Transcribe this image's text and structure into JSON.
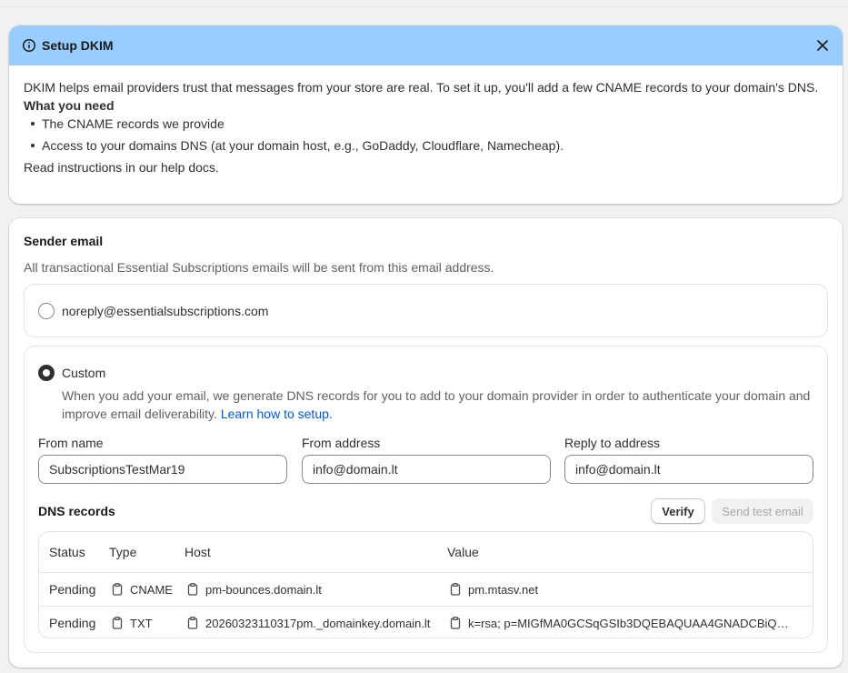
{
  "banner": {
    "title": "Setup DKIM",
    "intro": "DKIM helps email providers trust that messages from your store are real. To set it up, you'll add a few CNAME records to your domain's DNS.",
    "need_title": "What you need",
    "needs": [
      "The CNAME records we provide",
      "Access to your domains DNS (at your domain host, e.g., GoDaddy, Cloudflare, Namecheap)."
    ],
    "docs_text": "Read instructions in our help docs.",
    "header_color": "#99ccff"
  },
  "sender": {
    "title": "Sender email",
    "subtitle": "All transactional Essential Subscriptions emails will be sent from this email address.",
    "options": {
      "noreply": "noreply@essentialsubscriptions.com",
      "custom": "Custom"
    },
    "selected": "custom",
    "custom_desc": "When you add your email, we generate DNS records for you to add to your domain provider in order to authenticate your domain and improve email deliverability.",
    "learn_link": "Learn how to setup.",
    "fields": {
      "from_name": {
        "label": "From name",
        "value": "SubscriptionsTestMar19"
      },
      "from_address": {
        "label": "From address",
        "value": "info@domain.lt"
      },
      "reply_to": {
        "label": "Reply to address",
        "value": "info@domain.lt"
      }
    }
  },
  "dns": {
    "title": "DNS records",
    "verify_label": "Verify",
    "send_test_label": "Send test email",
    "columns": [
      "Status",
      "Type",
      "Host",
      "Value"
    ],
    "rows": [
      {
        "status": "Pending",
        "type": "CNAME",
        "host": "pm-bounces.domain.lt",
        "value": "pm.mtasv.net"
      },
      {
        "status": "Pending",
        "type": "TXT",
        "host": "20260323110317pm._domainkey.domain.lt",
        "value": "k=rsa; p=MIGfMA0GCSqGSIb3DQEBAQUAA4GNADCBiQKB..."
      }
    ]
  },
  "colors": {
    "link": "#005bd3",
    "text": "#303030",
    "muted": "#616161"
  }
}
